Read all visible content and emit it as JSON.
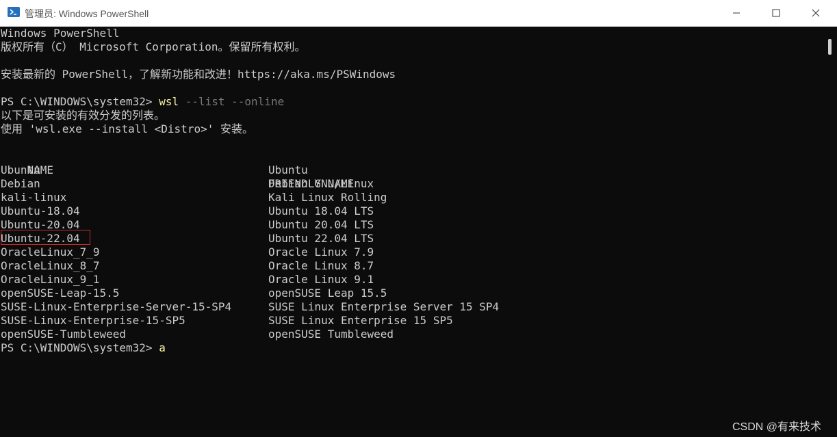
{
  "window": {
    "title": "管理员: Windows PowerShell",
    "icon": "powershell-icon",
    "controls": [
      "minimize-icon",
      "maximize-icon",
      "close-icon"
    ]
  },
  "console": {
    "header_line1": "Windows PowerShell",
    "header_line2": "版权所有（C） Microsoft Corporation。保留所有权利。",
    "header_line3": "安装最新的 PowerShell，了解新功能和改进！https://aka.ms/PSWindows",
    "prompt": "PS C:\\WINDOWS\\system32> ",
    "command": "wsl",
    "command_args": " --list --online",
    "output_line1": "以下是可安装的有效分发的列表。",
    "output_line2": "使用 'wsl.exe --install <Distro>' 安装。",
    "columns": [
      "NAME",
      "FRIENDLY NAME"
    ],
    "distros": [
      {
        "name": "Ubuntu",
        "friendly": "Ubuntu"
      },
      {
        "name": "Debian",
        "friendly": "Debian GNU/Linux"
      },
      {
        "name": "kali-linux",
        "friendly": "Kali Linux Rolling"
      },
      {
        "name": "Ubuntu-18.04",
        "friendly": "Ubuntu 18.04 LTS"
      },
      {
        "name": "Ubuntu-20.04",
        "friendly": "Ubuntu 20.04 LTS"
      },
      {
        "name": "Ubuntu-22.04",
        "friendly": "Ubuntu 22.04 LTS"
      },
      {
        "name": "OracleLinux_7_9",
        "friendly": "Oracle Linux 7.9"
      },
      {
        "name": "OracleLinux_8_7",
        "friendly": "Oracle Linux 8.7"
      },
      {
        "name": "OracleLinux_9_1",
        "friendly": "Oracle Linux 9.1"
      },
      {
        "name": "openSUSE-Leap-15.5",
        "friendly": "openSUSE Leap 15.5"
      },
      {
        "name": "SUSE-Linux-Enterprise-Server-15-SP4",
        "friendly": "SUSE Linux Enterprise Server 15 SP4"
      },
      {
        "name": "SUSE-Linux-Enterprise-15-SP5",
        "friendly": "SUSE Linux Enterprise 15 SP5"
      },
      {
        "name": "openSUSE-Tumbleweed",
        "friendly": "openSUSE Tumbleweed"
      }
    ],
    "highlighted_distro": "Ubuntu-22.04",
    "last_prompt": "PS C:\\WINDOWS\\system32> ",
    "typed_input": "a"
  },
  "watermark": "CSDN @有来技术",
  "colors": {
    "background": "#0c0c0c",
    "text": "#cccccc",
    "command": "#f9f1a5",
    "args": "#767676",
    "highlight": "#c42b2b",
    "icon_blue": "#2671be"
  }
}
